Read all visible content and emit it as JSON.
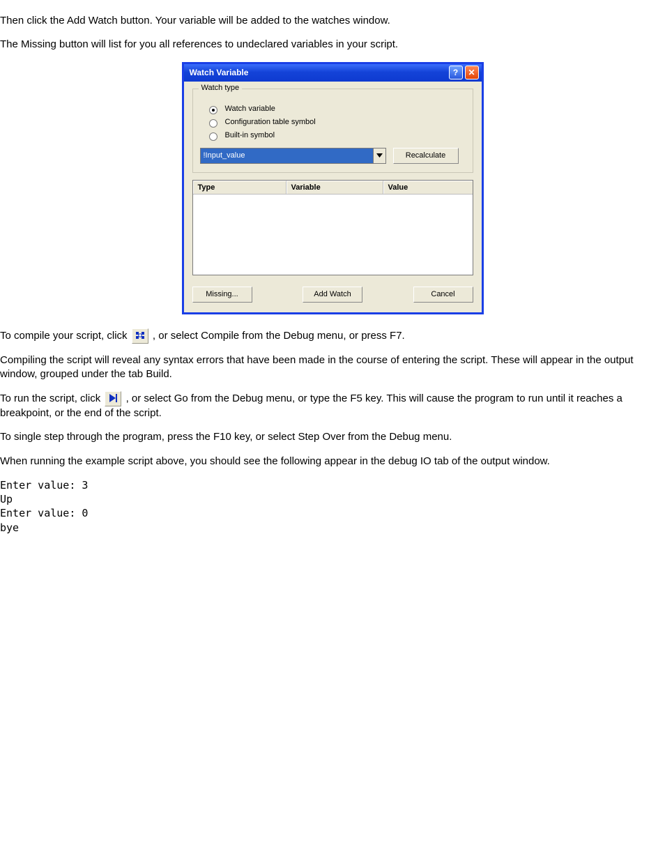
{
  "intro": {
    "p1": "Then click the Add Watch button. Your variable will be added to the watches window.",
    "p2": "The Missing button will list for you all references to undeclared variables in your script."
  },
  "dialog": {
    "title": "Watch Variable",
    "group_legend": "Watch type",
    "radios": {
      "watch_variable": "Watch variable",
      "config_symbol": "Configuration table symbol",
      "builtin_symbol": "Built-in symbol"
    },
    "combo_value": "!Input_value",
    "recalculate": "Recalculate",
    "columns": {
      "type": "Type",
      "variable": "Variable",
      "value": "Value"
    },
    "buttons": {
      "missing": "Missing...",
      "add_watch": "Add Watch",
      "cancel": "Cancel"
    }
  },
  "below": {
    "line1_a": "To compile your script, click",
    "line1_b": ", or select Compile from the Debug menu, or press F7.",
    "line2": "Compiling the script will reveal any syntax errors that have been made in the course of entering the script. These will appear in the output window, grouped under the tab Build.",
    "line3_a": "To run the script, click",
    "line3_b": ", or select Go from the Debug menu, or type the F5 key. This will cause the program to run until it reaches a breakpoint, or the end of the script.",
    "line4": "To single step through the program, press the F10 key, or select Step Over from the Debug menu.",
    "line5": "When running the example script above, you should see the following appear in the debug IO tab of the output window.",
    "output_block": "Enter value: 3\nUp\nEnter value: 0\nbye"
  }
}
